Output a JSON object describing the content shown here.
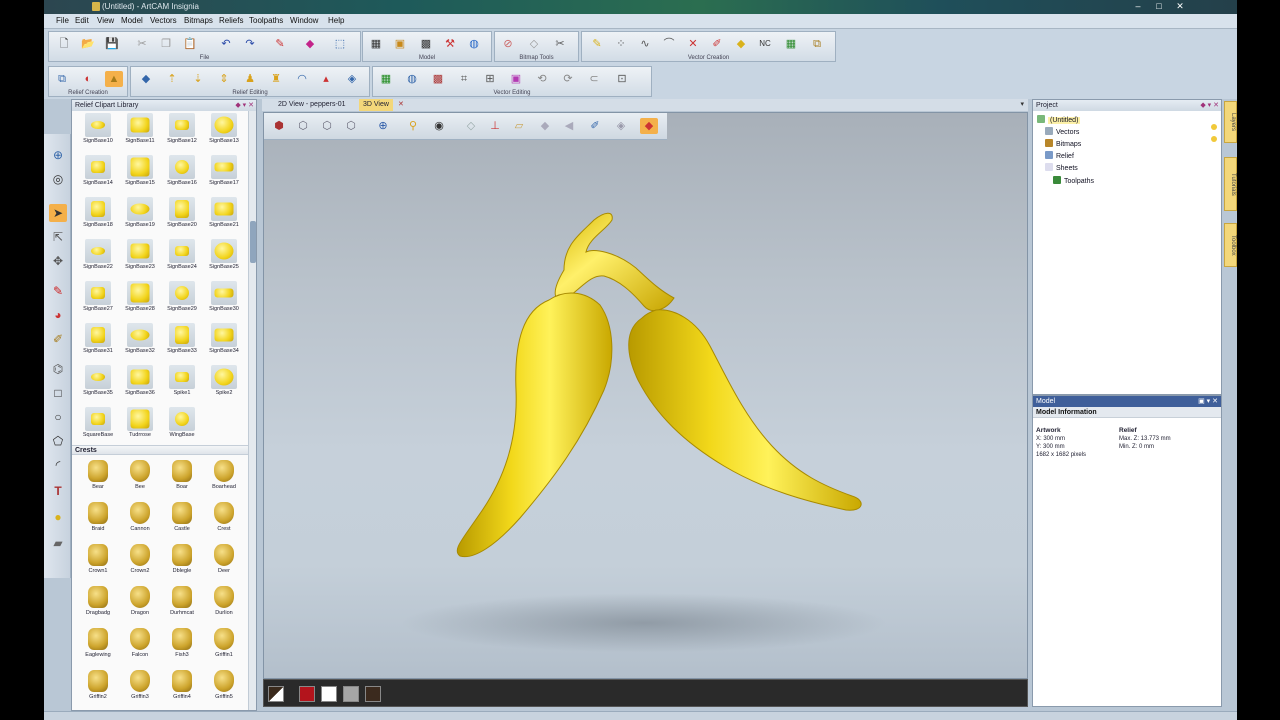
{
  "window": {
    "title": "(Untitled) - ArtCAM Insignia",
    "controls": [
      "–",
      "□",
      "✕"
    ]
  },
  "menu": [
    "File",
    "Edit",
    "View",
    "Model",
    "Vectors",
    "Bitmaps",
    "Reliefs",
    "Toolpaths",
    "Window",
    "Help"
  ],
  "toolbars": {
    "file_caption": "File",
    "model_caption": "Model",
    "bitmap_caption": "Bitmap Tools",
    "vector_creation_caption": "Vector Creation",
    "relief_creation_caption": "Relief Creation",
    "relief_editing_caption": "Relief Editing",
    "vector_editing_caption": "Vector Editing"
  },
  "library": {
    "title": "Relief Clipart Library",
    "controls": "◆ ▾ ✕",
    "signbases": [
      "SignBase10",
      "SignBase11",
      "SignBase12",
      "SignBase13",
      "SignBase14",
      "SignBase15",
      "SignBase16",
      "SignBase17",
      "SignBase18",
      "SignBase19",
      "SignBase20",
      "SignBase21",
      "SignBase22",
      "SignBase23",
      "SignBase24",
      "SignBase25",
      "SignBase27",
      "SignBase28",
      "SignBase29",
      "SignBase30",
      "SignBase31",
      "SignBase32",
      "SignBase33",
      "SignBase34",
      "SignBase35",
      "SignBase36",
      "Spike1",
      "Spike2",
      "SquareBase",
      "Tudrrose",
      "WingBase"
    ],
    "crests_header": "Crests",
    "crests": [
      "Bear",
      "Bee",
      "Boar",
      "Boarhead",
      "Braid",
      "Cannon",
      "Castle",
      "Crest",
      "Crown1",
      "Crown2",
      "Dblegle",
      "Deer",
      "Dragbadg",
      "Dragon",
      "Durhmcat",
      "Durlion",
      "Eaglewing",
      "Falcon",
      "Fish3",
      "Griffin1",
      "Griffin2",
      "Griffin3",
      "Griffin4",
      "Griffin5"
    ]
  },
  "doc_tabs": {
    "tab_2d": "2D View - peppers-01",
    "tab_3d": "3D View"
  },
  "swatches": [
    "#3a2a1c",
    "#b3141c",
    "#ffffff",
    "#a6a6a6",
    "#3b2a1e"
  ],
  "project": {
    "title": "Project",
    "controls": "◆ ▾ ✕",
    "items": [
      "(Untitled)",
      "Vectors",
      "Bitmaps",
      "Relief",
      "Sheets",
      "Toolpaths"
    ]
  },
  "model_info": {
    "title": "Model",
    "subtitle": "Model Information",
    "artwork_header": "Artwork",
    "artwork_x": "X: 300 mm",
    "artwork_y": "Y: 300 mm",
    "artwork_px": "1682 x 1682 pixels",
    "relief_header": "Relief",
    "relief_max": "Max. Z: 13.773 mm",
    "relief_min": "Min. Z: 0 mm"
  },
  "side_tabs": [
    "Layers",
    "Tutorials",
    "Toolbox"
  ]
}
